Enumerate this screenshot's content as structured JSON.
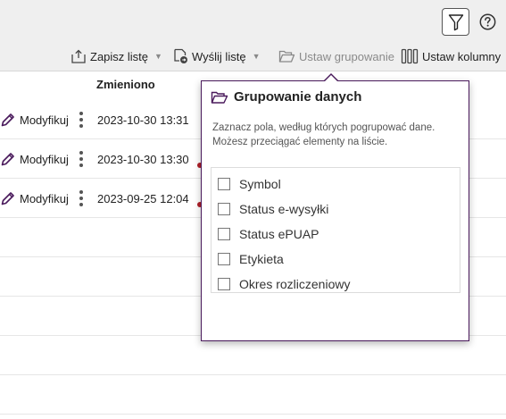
{
  "toolbar": {
    "save_list": "Zapisz listę",
    "send_list": "Wyślij listę",
    "set_grouping": "Ustaw grupowanie",
    "set_columns": "Ustaw kolumny"
  },
  "header_icons": {
    "filter": "filter-icon",
    "help": "help-icon"
  },
  "table": {
    "columns": [
      "Zmieniono"
    ],
    "rows": [
      {
        "action": "Modyfikuj",
        "changed": "2023-10-30 13:31"
      },
      {
        "action": "Modyfikuj",
        "changed": "2023-10-30 13:30"
      },
      {
        "action": "Modyfikuj",
        "changed": "2023-09-25 12:04"
      }
    ]
  },
  "grouping_popup": {
    "title": "Grupowanie danych",
    "description": "Zaznacz pola, według których pogrupować dane. Możesz przeciągać elementy na liście.",
    "fields": [
      {
        "label": "Symbol",
        "checked": false
      },
      {
        "label": "Status e-wysyłki",
        "checked": false
      },
      {
        "label": "Status ePUAP",
        "checked": false
      },
      {
        "label": "Etykieta",
        "checked": false
      },
      {
        "label": "Okres rozliczeniowy",
        "checked": false
      }
    ]
  },
  "colors": {
    "accent": "#4a1a5c",
    "header_bg": "#efefef",
    "status_mark": "#b0202a"
  }
}
